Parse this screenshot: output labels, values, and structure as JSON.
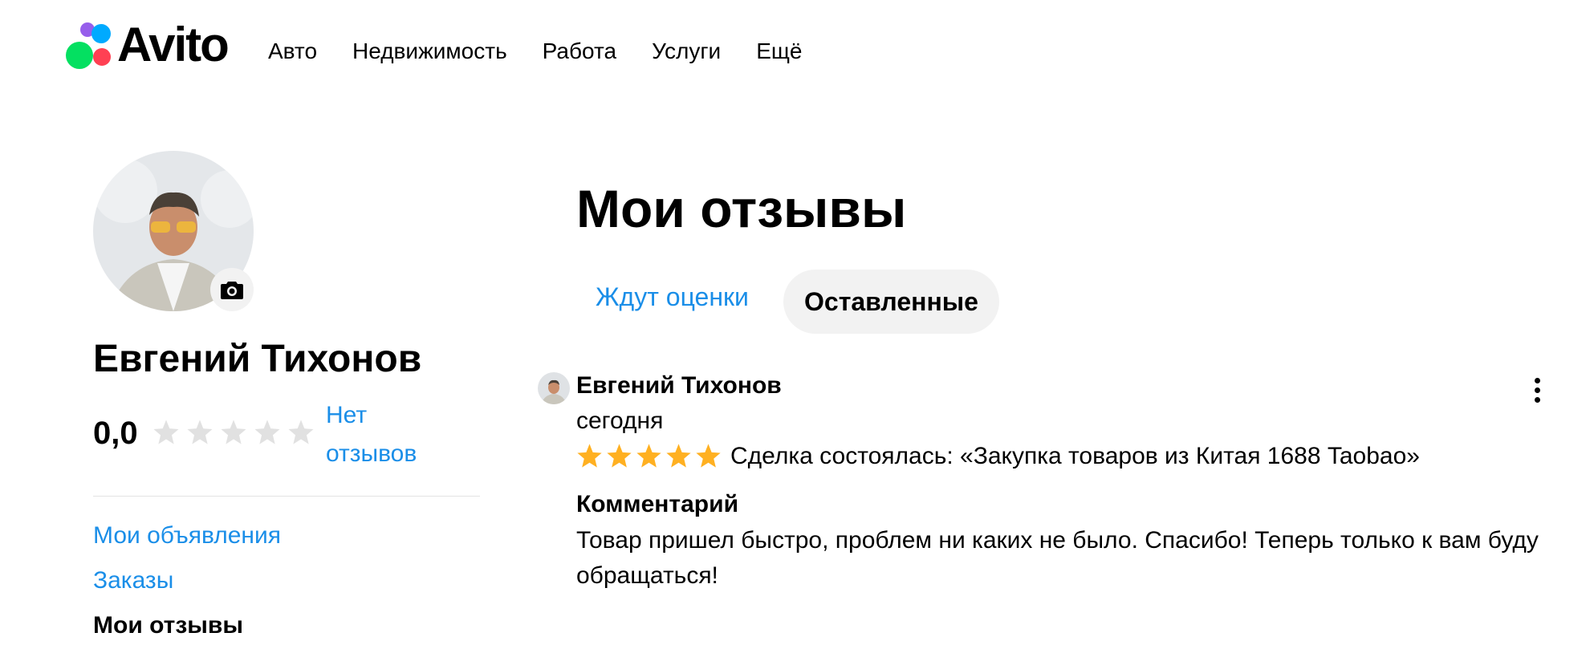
{
  "header": {
    "logo_text": "Avito",
    "logo_colors": [
      "#965eeb",
      "#0af",
      "#04e061",
      "#ff4053"
    ],
    "nav": [
      "Авто",
      "Недвижимость",
      "Работа",
      "Услуги",
      "Ещё"
    ]
  },
  "profile": {
    "name": "Евгений Тихонов",
    "rating": "0,0",
    "rating_stars": 0,
    "no_reviews_label": "Нет отзывов",
    "menu": {
      "items": [
        "Мои объявления",
        "Заказы"
      ],
      "active": "Мои отзывы"
    }
  },
  "main": {
    "title": "Мои отзывы",
    "tabs": {
      "pending": "Ждут оценки",
      "left": "Оставленные"
    },
    "review": {
      "author": "Евгений Тихонов",
      "date": "сегодня",
      "stars": 5,
      "deal": "Сделка состоялась: «Закупка товаров из Китая 1688 Taobao»",
      "comment_heading": "Комментарий",
      "comment": "Товар пришел быстро, проблем ни каких не было. Спасибо! Теперь только к вам буду обращаться!"
    }
  },
  "colors": {
    "link": "#1a8ee8",
    "star_filled": "#ffb021",
    "star_empty": "#e1e1e1",
    "tab_active_bg": "#f2f2f2"
  },
  "icons": [
    "camera-icon",
    "star-icon",
    "more-vertical-icon"
  ]
}
